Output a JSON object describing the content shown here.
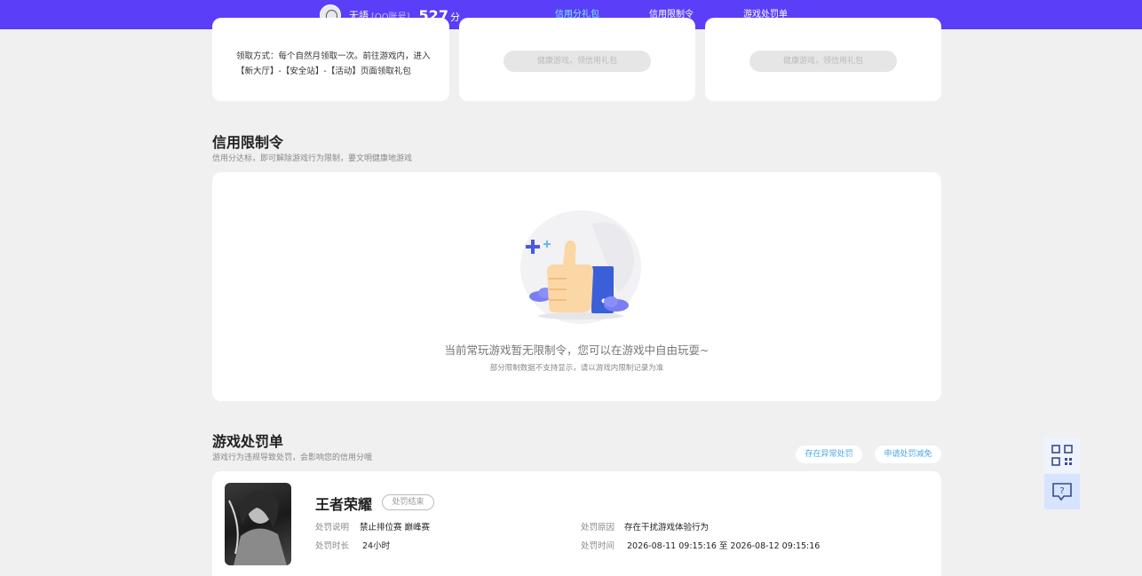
{
  "header": {
    "user_name": "无語",
    "account_type": "[QQ账号]",
    "score": "527",
    "score_unit": "分",
    "nav": [
      {
        "label": "信用分礼包",
        "active": true
      },
      {
        "label": "信用限制令",
        "active": false
      },
      {
        "label": "游戏处罚单",
        "active": false
      }
    ]
  },
  "gift_cards": {
    "claim_text": "领取方式：每个自然月领取一次。前往游戏内，进入【新大厅】-【安全站】-【活动】页面领取礼包",
    "disabled_button_label": "健康游戏，领信用礼包"
  },
  "restriction": {
    "title": "信用限制令",
    "subtitle": "信用分达标，即可解除游戏行为限制，要文明健康地游戏",
    "empty_message": "当前常玩游戏暂无限制令，您可以在游戏中自由玩耍~",
    "empty_note": "部分限制数据不支持显示，请以游戏内限制记录为准"
  },
  "penalty": {
    "title": "游戏处罚单",
    "subtitle": "游戏行为违规导致处罚，会影响您的信用分哦",
    "btn_abnormal": "存在异常处罚",
    "btn_appeal": "申请处罚减免",
    "record": {
      "game": "王者荣耀",
      "status": "处罚结束",
      "desc_label": "处罚说明",
      "desc_value": "禁止排位赛 巅峰赛",
      "duration_label": "处罚时长",
      "duration_value": "24小时",
      "reason_label": "处罚原因",
      "reason_value": "存在干扰游戏体验行为",
      "time_label": "处罚时间",
      "time_value": "2026-08-11 09:15:16 至 2026-08-12 09:15:16"
    }
  },
  "floating": {
    "qr_icon": "qrcode-icon",
    "help_icon": "help-chat-icon",
    "accent_color": "#5a3ef8"
  }
}
